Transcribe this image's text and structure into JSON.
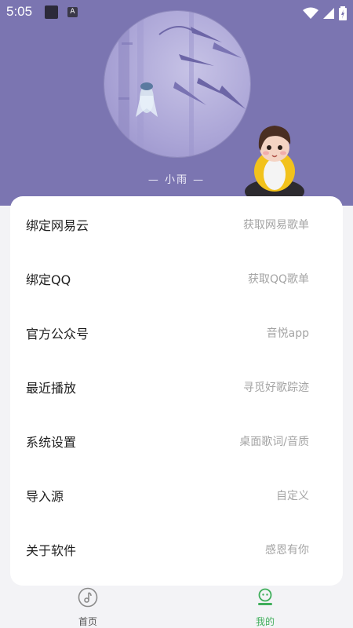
{
  "status_bar": {
    "time": "5:05",
    "badge": "A"
  },
  "profile": {
    "nickname": "— 小雨 —"
  },
  "menu": [
    {
      "label": "绑定网易云",
      "value": "获取网易歌单"
    },
    {
      "label": "绑定QQ",
      "value": "获取QQ歌单"
    },
    {
      "label": "官方公众号",
      "value": "音悦app"
    },
    {
      "label": "最近播放",
      "value": "寻觅好歌踪迹"
    },
    {
      "label": "系统设置",
      "value": "桌面歌词/音质"
    },
    {
      "label": "导入源",
      "value": "自定义"
    },
    {
      "label": "关于软件",
      "value": "感恩有你"
    }
  ],
  "tabs": [
    {
      "label": "首页",
      "icon": "music-disc-icon",
      "active": false,
      "color": "#7a7a7a"
    },
    {
      "label": "我的",
      "icon": "profile-icon",
      "active": true,
      "color": "#3fae5b"
    }
  ],
  "colors": {
    "header": "#7b75b1",
    "accent": "#3fae5b",
    "card": "#ffffff"
  }
}
